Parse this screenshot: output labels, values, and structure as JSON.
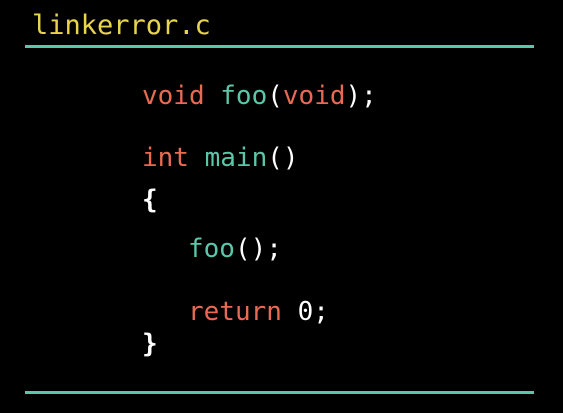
{
  "file": {
    "title": "linkerror.c"
  },
  "code": {
    "line1": {
      "kw1": "void",
      "sp1": " ",
      "fn": "foo",
      "p1": "(",
      "kw2": "void",
      "p2": ");"
    },
    "line2": {
      "kw": "int",
      "sp": " ",
      "fn": "main",
      "p": "()"
    },
    "line3": {
      "brace": "{"
    },
    "line4": {
      "fn": "foo",
      "p": "();"
    },
    "line5": {
      "kw": "return",
      "sp": " ",
      "num": "0",
      "p": ";"
    },
    "line6": {
      "brace": "}"
    }
  },
  "colors": {
    "background": "#000000",
    "title": "#e8d44d",
    "keyword": "#e86a52",
    "function": "#5cc6a8",
    "rule": "#5cc6a8",
    "text": "#ffffff"
  }
}
